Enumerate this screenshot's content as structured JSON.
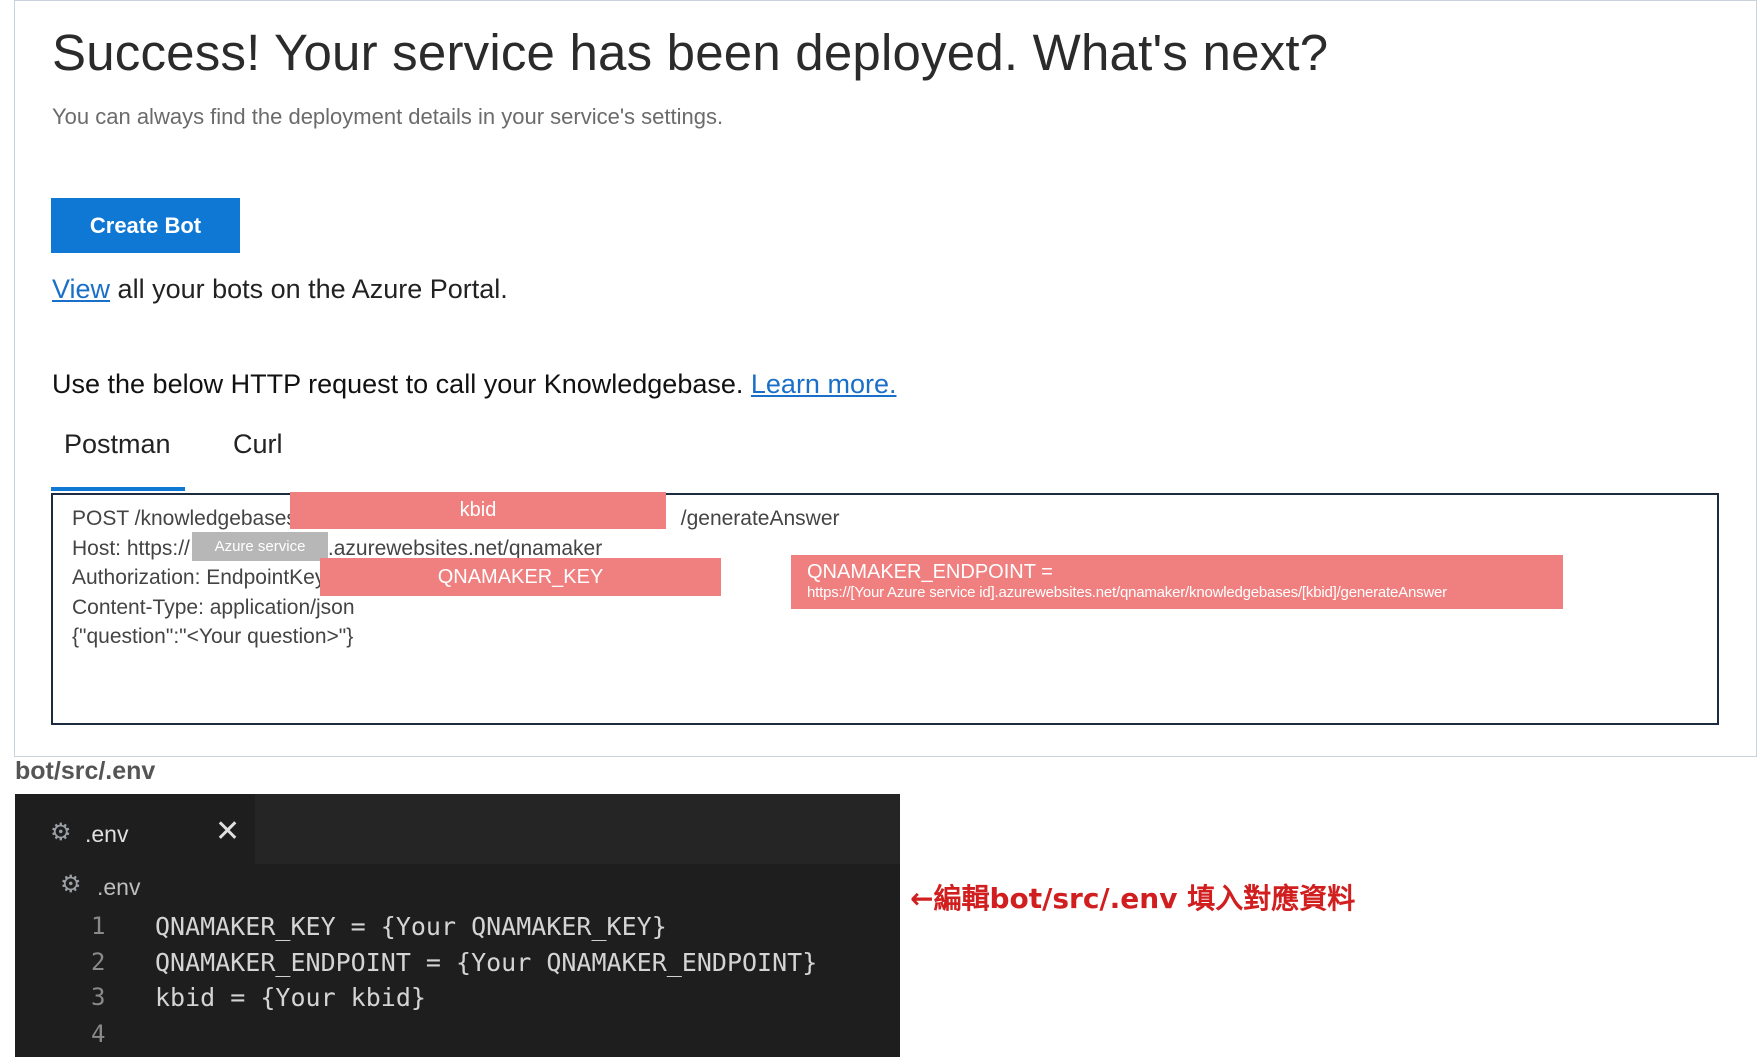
{
  "header": {
    "title": "Success! Your service has been deployed. What's next?",
    "subtitle": "You can always find the deployment details in your service's settings."
  },
  "actions": {
    "create_bot_label": "Create Bot",
    "view_link": "View",
    "view_rest": " all your bots on the Azure Portal."
  },
  "http_section": {
    "intro": "Use the below HTTP request to call your Knowledgebase. ",
    "learn_more": "Learn more.",
    "tabs": [
      {
        "label": "Postman",
        "active": true
      },
      {
        "label": "Curl",
        "active": false
      }
    ]
  },
  "request": {
    "line1_prefix": "POST /knowledgebases/",
    "line1_suffix": "/generateAnswer",
    "line2_prefix": "Host: https://",
    "line2_suffix": ".azurewebsites.net/qnamaker",
    "line3_prefix": "Authorization: EndpointKey",
    "line4": "Content-Type: application/json",
    "line5": "{\"question\":\"<Your question>\"}"
  },
  "annotations": {
    "kbid": "kbid",
    "azure_service": "Azure service",
    "qnamaker_key": "QNAMAKER_KEY",
    "endpoint_title": "QNAMAKER_ENDPOINT =",
    "endpoint_url": "https://[Your Azure service id].azurewebsites.net/qnamaker/knowledgebases/[kbid]/generateAnswer",
    "highlight_color": "#f08080"
  },
  "file_label": "bot/src/.env",
  "editor": {
    "tab_name": ".env",
    "breadcrumb": ".env",
    "line_numbers": [
      "1",
      "2",
      "3",
      "4"
    ],
    "lines": [
      "QNAMAKER_KEY = {Your QNAMAKER_KEY}",
      "QNAMAKER_ENDPOINT = {Your QNAMAKER_ENDPOINT}",
      "kbid = {Your kbid}",
      ""
    ]
  },
  "note": "←編輯bot/src/.env 填入對應資料",
  "colors": {
    "accent": "#0f78d4",
    "link": "#1a6fc8",
    "note": "#d11f1f",
    "editor_bg": "#1e1e1e"
  }
}
